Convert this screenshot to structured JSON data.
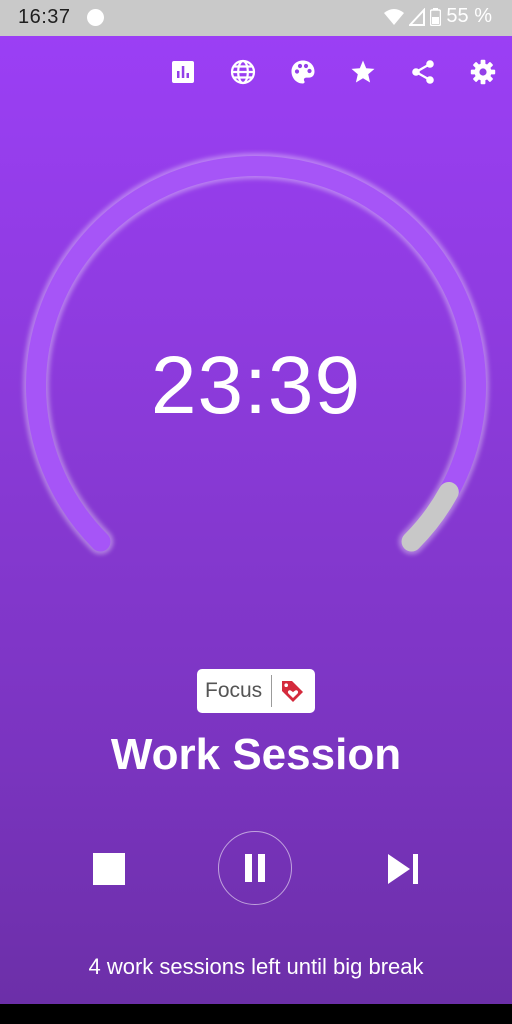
{
  "status_bar": {
    "time": "16:37",
    "battery_percent": "55 %"
  },
  "toolbar": {
    "icons": [
      "bar-chart-icon",
      "globe-icon",
      "palette-icon",
      "star-icon",
      "share-icon",
      "gear-icon"
    ]
  },
  "timer": {
    "display": "23:39",
    "progress_fraction": 0.06
  },
  "tag": {
    "label": "Focus",
    "icon": "tag-heart-icon"
  },
  "session": {
    "title": "Work Session"
  },
  "controls": {
    "icons": [
      "stop-icon",
      "pause-icon",
      "skip-next-icon"
    ]
  },
  "footer": {
    "sessions_left_text": "4 work sessions left until big break"
  },
  "colors": {
    "background_top": "#9b3ff5",
    "background_bottom": "#6c2fa8",
    "progress_track": "#a655f7",
    "progress_fill": "#c8c8c8",
    "tag_icon": "#d42a3c"
  }
}
